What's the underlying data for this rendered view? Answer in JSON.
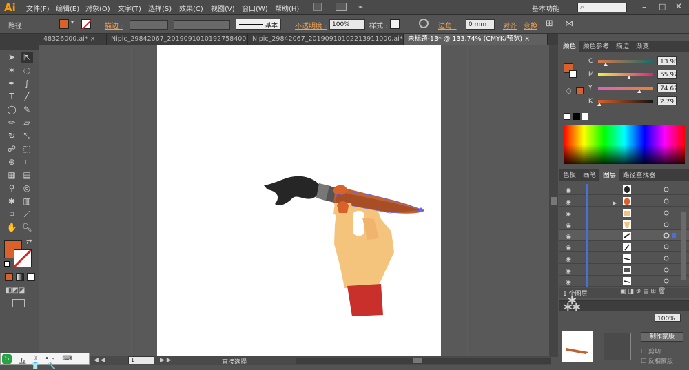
{
  "menubar": {
    "logo": "Ai",
    "items": [
      "文件(F)",
      "编辑(E)",
      "对象(O)",
      "文字(T)",
      "选择(S)",
      "效果(C)",
      "视图(V)",
      "窗口(W)",
      "帮助(H)"
    ],
    "workspace": "基本功能",
    "search_icon": "search-icon"
  },
  "control_bar": {
    "selection_label": "路径",
    "fill_color": "#d9622b",
    "stroke_label": "描边 :",
    "brush_label": "基本",
    "opacity_label": "不透明度 :",
    "opacity_value": "100%",
    "style_label": "样式 :",
    "corner_label": "边角 :",
    "corner_value": "0 mm",
    "align_label": "对齐",
    "transform_label": "变换"
  },
  "tabs": [
    {
      "label": "48326000.ai* ×",
      "active": false
    },
    {
      "label": "Nipic_29842067_20190910101927584000.ai* ×",
      "active": false
    },
    {
      "label": "Nipic_29842067_20190910102213911000.ai* ×",
      "active": false
    },
    {
      "label": "未标题-13* @ 133.74% (CMYK/预览) ×",
      "active": true
    }
  ],
  "color_panel": {
    "tabs": [
      "颜色",
      "颜色参考",
      "描边",
      "渐变"
    ],
    "channels": [
      {
        "name": "C",
        "value": "13.98",
        "pos": 0.14
      },
      {
        "name": "M",
        "value": "55.97",
        "pos": 0.56
      },
      {
        "name": "Y",
        "value": "74.62",
        "pos": 0.75
      },
      {
        "name": "K",
        "value": "2.79",
        "pos": 0.03
      }
    ],
    "fill_color": "#d9622b"
  },
  "layers_panel": {
    "tabs": [
      "色板",
      "画笔",
      "图层",
      "路径查找器"
    ],
    "footer": "1 个图层",
    "rows": 9
  },
  "bottom_panel": {
    "opacity_value": "100%",
    "make_mask_label": "制作蒙版",
    "clip_label": "剪切",
    "invert_label": "反相蒙版"
  },
  "statusbar": {
    "zoom": "1",
    "tool": "直接选择"
  },
  "ime_bar": {
    "label": "五"
  }
}
